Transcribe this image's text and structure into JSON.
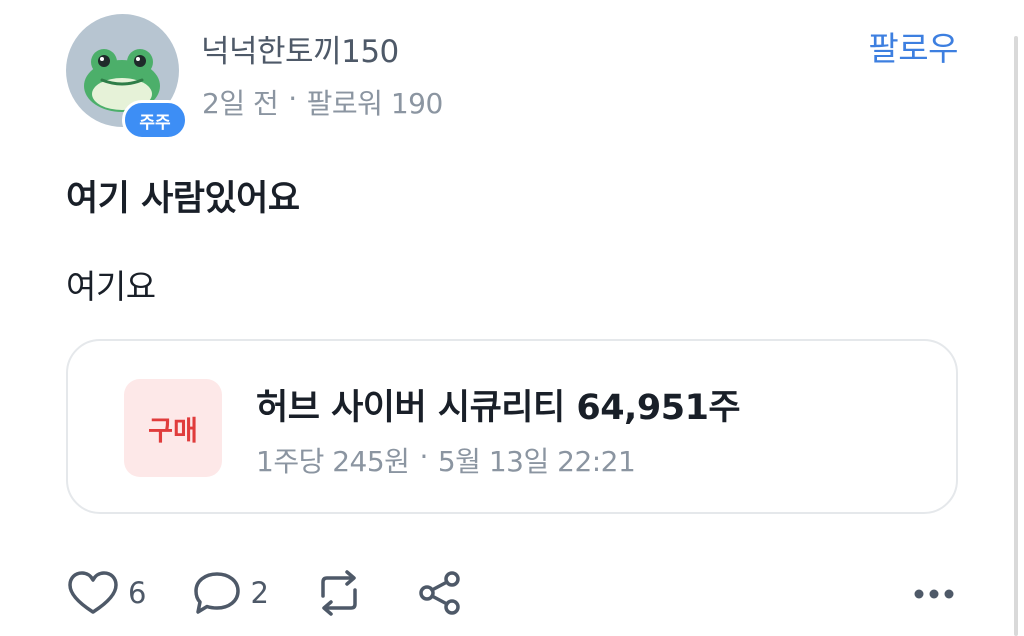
{
  "author": {
    "name": "넉넉한토끼150",
    "badge": "주주",
    "avatar_icon": "frog-icon",
    "time_ago": "2일 전",
    "separator": "·",
    "followers": "팔로워 190"
  },
  "follow_label": "팔로우",
  "post": {
    "title": "여기 사람있어요",
    "body": "여기요"
  },
  "trade": {
    "tag": "구매",
    "title": "허브 사이버 시큐리티 64,951주",
    "price": "1주당 245원",
    "separator": "·",
    "datetime": "5월 13일 22:21"
  },
  "actions": {
    "like_icon": "heart-icon",
    "like_count": "6",
    "comment_icon": "comment-icon",
    "comment_count": "2",
    "repost_icon": "repost-icon",
    "share_icon": "share-icon",
    "more_icon": "more-icon"
  },
  "colors": {
    "accent": "#3d7fe0",
    "badge": "#3d8ef5",
    "buy_tag_bg": "#fde8e8",
    "buy_tag_text": "#e03c3c",
    "muted_text": "#8b95a1"
  }
}
